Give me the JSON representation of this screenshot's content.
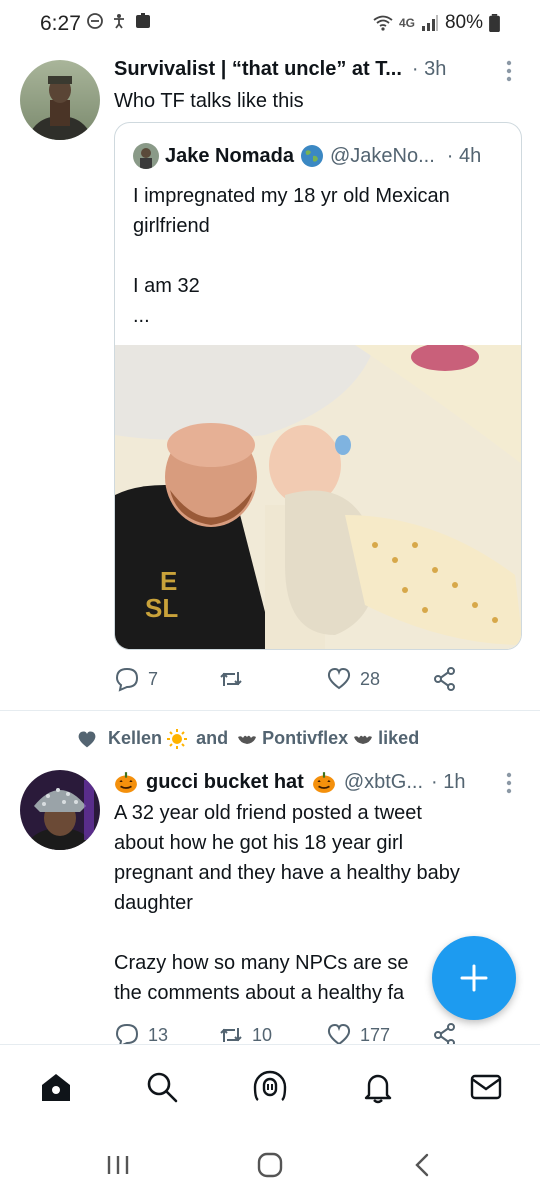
{
  "status_bar": {
    "time": "6:27",
    "network": "4G",
    "battery": "80%"
  },
  "tweet1": {
    "author_name": "Survivalist | “that uncle” at T...",
    "time": "· 3h",
    "text": "Who TF talks like this",
    "quote": {
      "author_name": "Jake Nomada",
      "handle": "@JakeNo...",
      "time": "· 4h",
      "lines": [
        "I impregnated my 18 yr old Mexican",
        "girlfriend",
        "",
        "I am 32",
        "..."
      ]
    },
    "actions": {
      "replies": "7",
      "retweets": "",
      "likes": "28"
    }
  },
  "social_context": {
    "name1": "Kellen",
    "and": "and",
    "name2": "Pontivflex",
    "suffix": "liked"
  },
  "tweet2": {
    "author_name": "gucci bucket hat",
    "handle": "@xbtG...",
    "time": "· 1h",
    "lines": [
      "A 32 year old friend posted a tweet",
      "about how he got his 18 year girl",
      "pregnant and they have a healthy baby",
      "daughter",
      "",
      "Crazy how so many NPCs are se",
      "the comments about a healthy fa"
    ],
    "actions": {
      "replies": "13",
      "retweets": "10",
      "likes": "177"
    }
  },
  "icons": {
    "fab": "plus-icon",
    "nav": [
      "home-icon",
      "search-icon",
      "spaces-icon",
      "notifications-icon",
      "messages-icon"
    ],
    "system": [
      "recents-icon",
      "home-button-icon",
      "back-icon"
    ]
  },
  "colors": {
    "accent": "#1d9bf0",
    "text": "#0f1419",
    "muted": "#536471"
  }
}
